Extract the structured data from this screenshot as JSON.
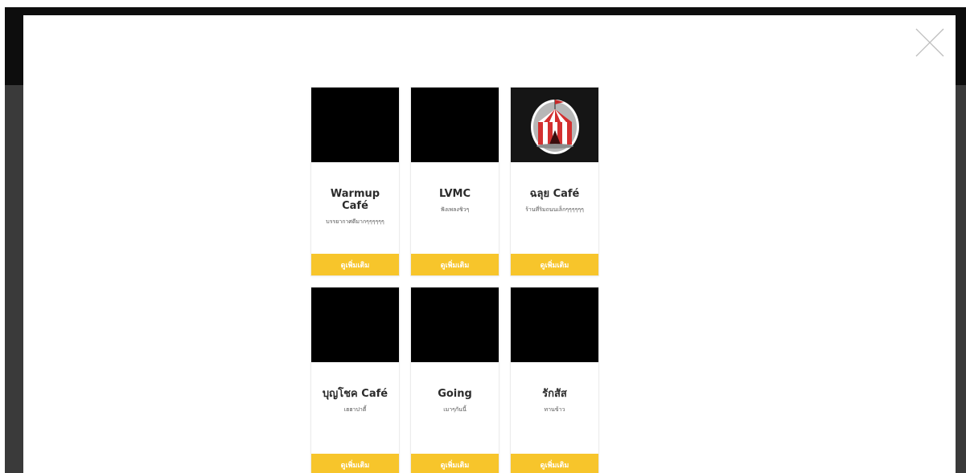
{
  "modal": {
    "cards": [
      {
        "title": "Warmup Café",
        "description": "บรรยากาศดีมากๆๆๆๆๆๆ",
        "button_label": "ดูเพิ่มเติม",
        "image": "black-placeholder"
      },
      {
        "title": "LVMC",
        "description": "ฟังเพลงชิวๆ",
        "button_label": "ดูเพิ่มเติม",
        "image": "black-placeholder"
      },
      {
        "title": "ฉลุย Café",
        "description": "ร้านที่ริมถนนเล็กๆๆๆๆๆๆ",
        "button_label": "ดูเพิ่มเติม",
        "image": "circus-tent-logo"
      },
      {
        "title": "บุญโชค Café",
        "description": "เฮฮาปาตี้",
        "button_label": "ดูเพิ่มเติม",
        "image": "black-placeholder"
      },
      {
        "title": "Going",
        "description": "เมาๆกันนี้",
        "button_label": "ดูเพิ่มเติม",
        "image": "black-placeholder"
      },
      {
        "title": "รักสัส",
        "description": "ทานข้าว",
        "button_label": "ดูเพิ่มเติม",
        "image": "black-placeholder"
      }
    ]
  },
  "colors": {
    "accent": "#f7c52b",
    "overlay_dark": "#0d0d0d",
    "overlay_gray": "#3a3a3a"
  }
}
